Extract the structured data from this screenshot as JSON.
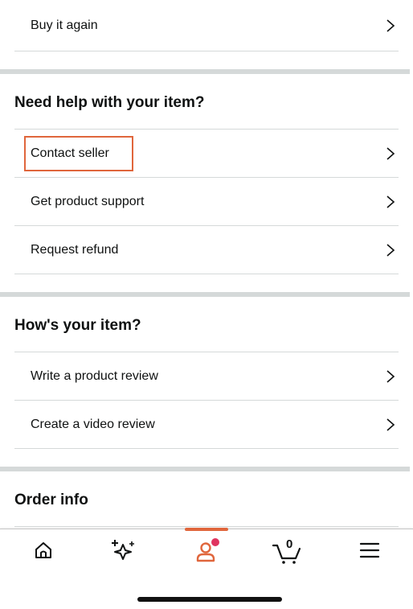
{
  "rows_top": [
    {
      "label": "Buy it again"
    }
  ],
  "section_help": {
    "title": "Need help with your item?",
    "items": [
      {
        "label": "Contact seller"
      },
      {
        "label": "Get product support"
      },
      {
        "label": "Request refund"
      }
    ]
  },
  "section_review": {
    "title": "How's your item?",
    "items": [
      {
        "label": "Write a product review"
      },
      {
        "label": "Create a video review"
      }
    ]
  },
  "section_order": {
    "title": "Order info"
  },
  "tabbar": {
    "tabs": [
      {
        "name": "home",
        "icon": "home-icon"
      },
      {
        "name": "ai-assistant",
        "icon": "sparkle-icon"
      },
      {
        "name": "account",
        "icon": "person-icon",
        "active": true
      },
      {
        "name": "cart",
        "icon": "cart-icon",
        "count": "0"
      },
      {
        "name": "menu",
        "icon": "hamburger-menu-icon"
      }
    ]
  },
  "colors": {
    "accent": "#e0663c",
    "notification_dot": "#e0345f",
    "divider": "#d5d9d9",
    "text": "#0f1111"
  }
}
